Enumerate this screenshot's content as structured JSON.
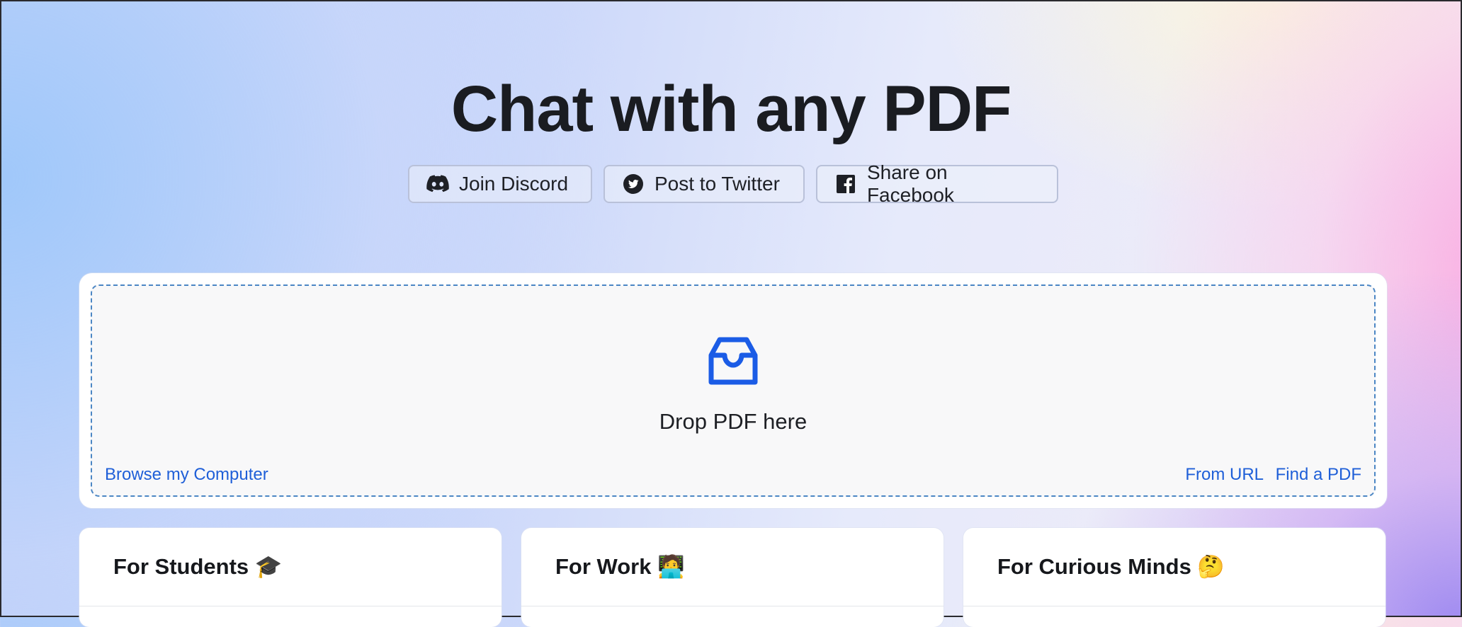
{
  "header": {
    "title": "Chat with any PDF"
  },
  "share_buttons": [
    {
      "label": "Join Discord",
      "icon": "discord-icon"
    },
    {
      "label": "Post to Twitter",
      "icon": "twitter-icon"
    },
    {
      "label": "Share on Facebook",
      "icon": "facebook-icon"
    }
  ],
  "upload": {
    "icon": "inbox-icon",
    "drop_text": "Drop PDF here",
    "browse_link": "Browse my Computer",
    "url_link": "From URL",
    "find_link": "Find a PDF"
  },
  "features": [
    {
      "title": "For Students 🎓"
    },
    {
      "title": "For Work 🧑‍💻"
    },
    {
      "title": "For Curious Minds 🤔"
    }
  ],
  "colors": {
    "link": "#1f5fd8",
    "icon_blue": "#1b5ce6",
    "dashed_border": "#4b86c4"
  }
}
